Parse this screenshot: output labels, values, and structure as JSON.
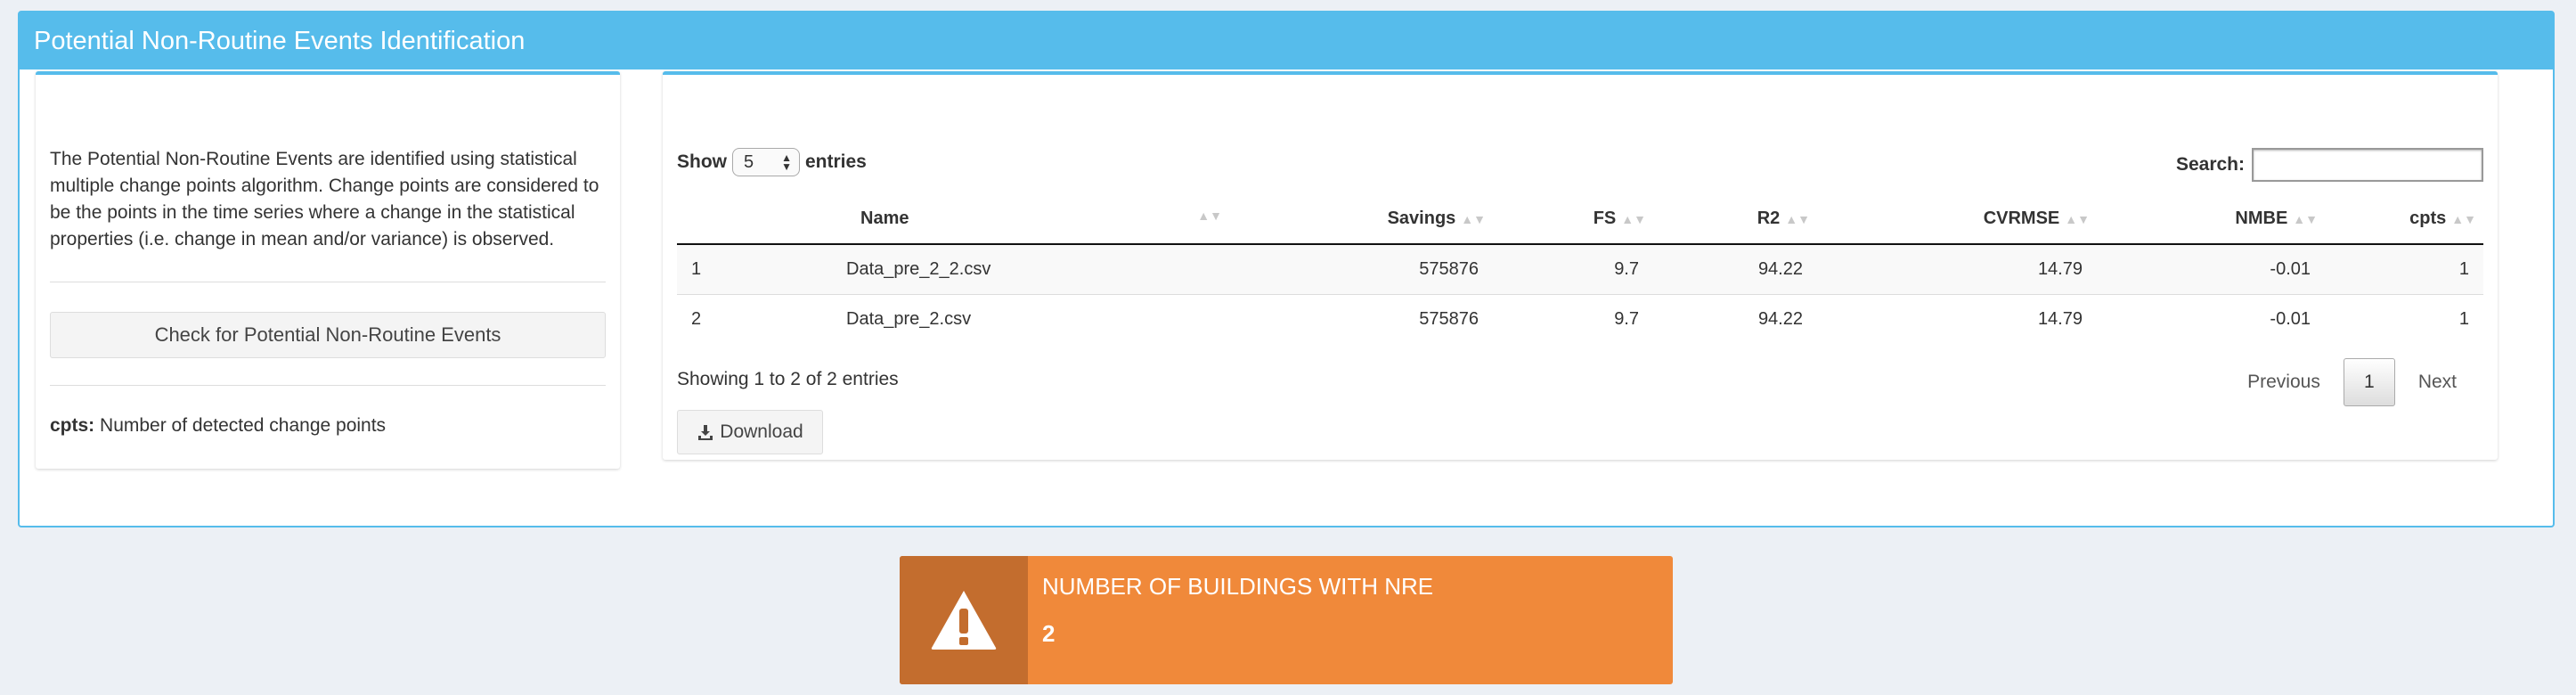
{
  "header": {
    "title": "Potential Non-Routine Events Identification"
  },
  "left_panel": {
    "description": "The Potential Non-Routine Events are identified using statistical multiple change points algorithm. Change points are considered to be the points in the time series where a change in the statistical properties (i.e. change in mean and/or variance) is observed.",
    "check_button": "Check for Potential Non-Routine Events",
    "legend_key": "cpts:",
    "legend_text": " Number of detected change points"
  },
  "table_controls": {
    "show_label": "Show",
    "show_value": "5",
    "entries_label": "entries",
    "search_label": "Search:",
    "search_value": ""
  },
  "table": {
    "columns": [
      "",
      "Name",
      "Savings",
      "FS",
      "R2",
      "CVRMSE",
      "NMBE",
      "cpts"
    ],
    "rows": [
      {
        "idx": "1",
        "name": "Data_pre_2_2.csv",
        "savings": "575876",
        "fs": "9.7",
        "r2": "94.22",
        "cvrmse": "14.79",
        "nmbe": "-0.01",
        "cpts": "1"
      },
      {
        "idx": "2",
        "name": "Data_pre_2.csv",
        "savings": "575876",
        "fs": "9.7",
        "r2": "94.22",
        "cvrmse": "14.79",
        "nmbe": "-0.01",
        "cpts": "1"
      }
    ]
  },
  "footer": {
    "info": "Showing 1 to 2 of 2 entries",
    "prev": "Previous",
    "page": "1",
    "next": "Next",
    "download": "Download"
  },
  "infobox": {
    "title": "NUMBER OF BUILDINGS WITH NRE",
    "value": "2",
    "icon": "warning-icon",
    "color": "#f0893a"
  },
  "colors": {
    "accent": "#56bceb",
    "warning_dark": "#c36d2e"
  }
}
